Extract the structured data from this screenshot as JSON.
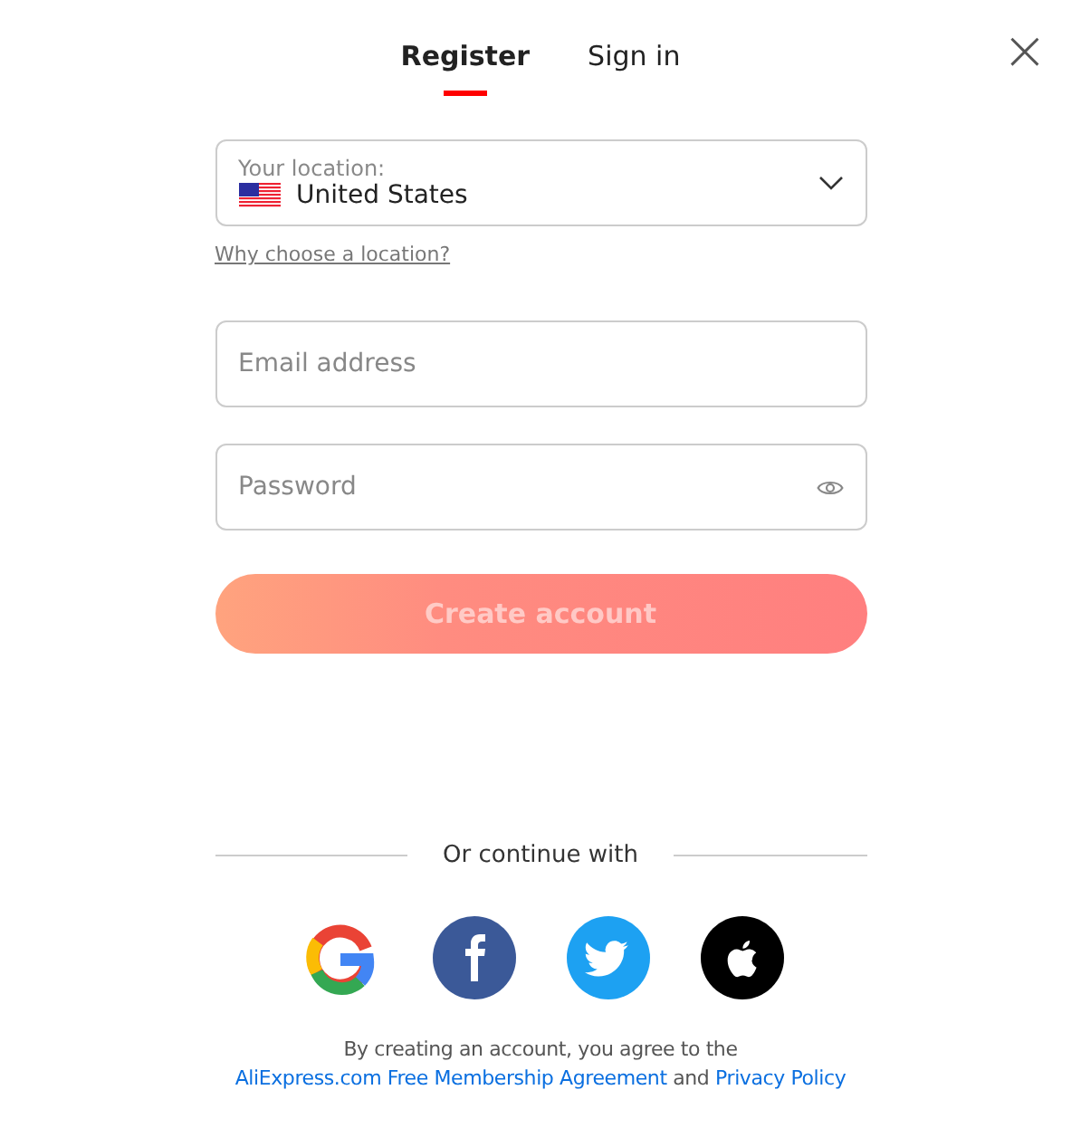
{
  "tabs": [
    {
      "label": "Register",
      "selected": true
    },
    {
      "label": "Sign in",
      "selected": false
    }
  ],
  "close": {
    "symbol": "×"
  },
  "location": {
    "label": "Your location:",
    "value": "United States"
  },
  "location_help": "Why choose a location?",
  "fields": [
    {
      "kind": "email",
      "placeholder": "Email address"
    },
    {
      "kind": "password",
      "placeholder": "Password"
    }
  ],
  "submit": {
    "label": "Create account",
    "disabled": true
  },
  "divider_text": "Or continue with",
  "social": [
    {
      "kind": "google"
    },
    {
      "kind": "facebook"
    },
    {
      "kind": "twitter"
    },
    {
      "kind": "apple"
    }
  ],
  "legal": {
    "text": "By creating an account, you agree to the",
    "link_1": "AliExpress.com Free Membership Agreement",
    "joiner": "and",
    "link_2": "Privacy Policy"
  }
}
